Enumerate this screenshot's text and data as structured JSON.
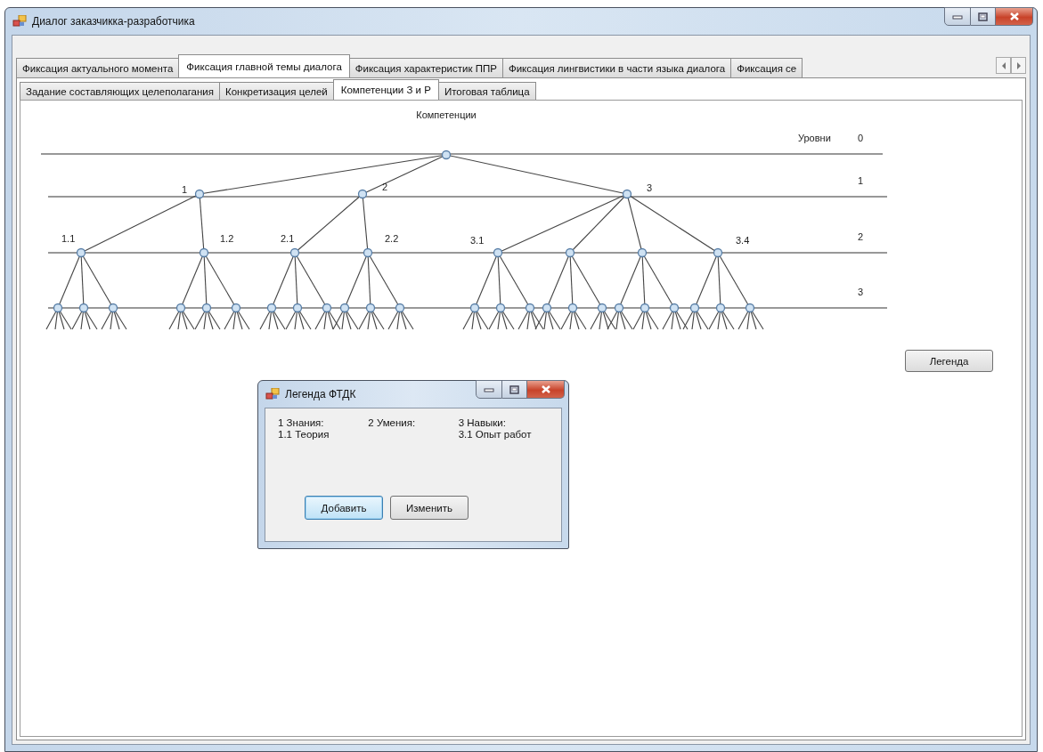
{
  "window": {
    "title": "Диалог заказчикка-разработчика"
  },
  "tabs": [
    {
      "label": "Фиксация актуального момента",
      "selected": false
    },
    {
      "label": "Фиксация главной темы диалога",
      "selected": true
    },
    {
      "label": "Фиксация характеристик ППР",
      "selected": false
    },
    {
      "label": "Фиксация лингвистики в части языка диалога",
      "selected": false
    },
    {
      "label": "Фиксация се",
      "selected": false
    }
  ],
  "subtabs": [
    {
      "label": "Задание составляющих целеполагания",
      "selected": false
    },
    {
      "label": "Конкретизация целей",
      "selected": false
    },
    {
      "label": "Компетенции З и Р",
      "selected": true
    },
    {
      "label": "Итоговая таблица",
      "selected": false
    }
  ],
  "diagram": {
    "title": "Компетенции",
    "levels_caption": "Уровни",
    "levels": [
      "0",
      "1",
      "2",
      "3"
    ],
    "root": {
      "children": [
        {
          "label": "1",
          "children": [
            {
              "kind": "node",
              "label": "1.1"
            },
            {
              "kind": "node",
              "label": "1.2"
            }
          ]
        },
        {
          "label": "2",
          "children": [
            {
              "kind": "node",
              "label": "2.1"
            },
            {
              "kind": "node",
              "label": "2.2"
            }
          ]
        },
        {
          "label": "3",
          "children": [
            {
              "kind": "node",
              "label": "3.1"
            },
            {
              "kind": "node"
            },
            {
              "kind": "node"
            },
            {
              "kind": "node",
              "label": "3.4"
            }
          ]
        }
      ]
    }
  },
  "legend_button": {
    "label": "Легенда"
  },
  "legend_dialog": {
    "title": "Легенда ФТДК",
    "columns": [
      {
        "lines": [
          "1 Знания:",
          "1.1 Теория"
        ]
      },
      {
        "lines": [
          "2 Умения:"
        ]
      },
      {
        "lines": [
          "3 Навыки:",
          "3.1 Опыт работ"
        ]
      }
    ],
    "buttons": [
      {
        "label": "Добавить",
        "focused": true
      },
      {
        "label": "Изменить",
        "focused": false
      }
    ]
  }
}
